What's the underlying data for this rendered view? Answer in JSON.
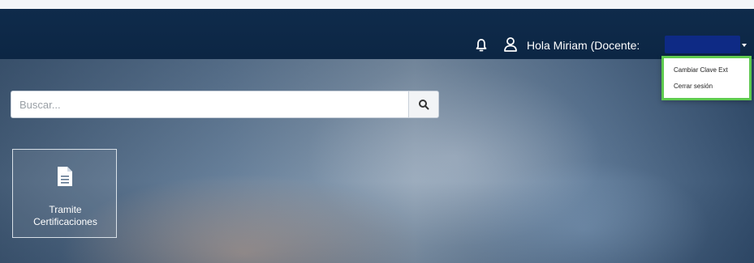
{
  "header": {
    "greeting": "Hola Miriam (Docente:",
    "icons": [
      "bell-icon",
      "user-icon"
    ],
    "user_menu": {
      "items": [
        "Cambiar Clave Ext",
        "Cerrar sesión"
      ]
    }
  },
  "search": {
    "placeholder": "Buscar..."
  },
  "tiles": [
    {
      "label_line1": "Tramite",
      "label_line2": "Certificaciones",
      "icon": "document-icon"
    }
  ],
  "colors": {
    "navbar": "#0f2b4b",
    "redaction": "#0e2a85",
    "dropdown_border": "#5fcb4f"
  }
}
